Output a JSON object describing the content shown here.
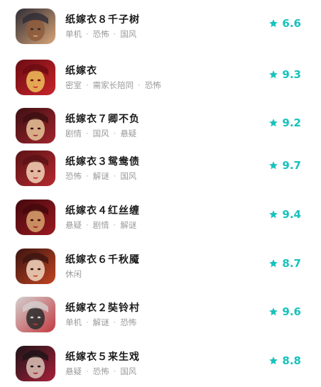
{
  "games": [
    {
      "name": "纸嫁衣８千子树",
      "tags": [
        "单机",
        "恐怖",
        "国风"
      ],
      "rating": "6.6",
      "icon": "game-cover-icon",
      "palette": [
        "#2e2c35",
        "#d9a577",
        "#8f5c3c"
      ]
    },
    {
      "name": "纸嫁衣",
      "tags": [
        "密室",
        "需家长陪同",
        "恐怖"
      ],
      "rating": "9.3",
      "icon": "game-cover-icon",
      "palette": [
        "#6b0b12",
        "#c9252b",
        "#f0c05a"
      ]
    },
    {
      "name": "纸嫁衣７卿不负",
      "tags": [
        "剧情",
        "国风",
        "悬疑"
      ],
      "rating": "9.2",
      "icon": "game-cover-icon",
      "palette": [
        "#3c0f12",
        "#a3252c",
        "#e8c79a"
      ]
    },
    {
      "name": "纸嫁衣３鸳鸯债",
      "tags": [
        "恐怖",
        "解谜",
        "国风"
      ],
      "rating": "9.7",
      "icon": "game-cover-icon",
      "palette": [
        "#5a1216",
        "#b52a2f",
        "#f3d3b8"
      ]
    },
    {
      "name": "纸嫁衣４红丝缠",
      "tags": [
        "悬疑",
        "剧情",
        "解谜"
      ],
      "rating": "9.4",
      "icon": "game-cover-icon",
      "palette": [
        "#42090d",
        "#9c1a20",
        "#d8a36e"
      ]
    },
    {
      "name": "纸嫁衣６千秋魇",
      "tags": [
        "休闲"
      ],
      "rating": "8.7",
      "icon": "game-cover-icon",
      "palette": [
        "#3b1410",
        "#c24422",
        "#f2d7bf"
      ]
    },
    {
      "name": "纸嫁衣２奘铃村",
      "tags": [
        "单机",
        "解谜",
        "恐怖"
      ],
      "rating": "9.6",
      "icon": "game-cover-icon",
      "palette": [
        "#d4d0cf",
        "#c23a3f",
        "#2b2b2b"
      ]
    },
    {
      "name": "纸嫁衣５来生戏",
      "tags": [
        "悬疑",
        "恐怖",
        "国风"
      ],
      "rating": "8.8",
      "icon": "game-cover-icon",
      "palette": [
        "#1d1418",
        "#a8203a",
        "#d9c2b6"
      ]
    }
  ],
  "colors": {
    "accent": "#18c2bc",
    "title": "#1a1a1a",
    "tags": "#9b9b9b"
  }
}
